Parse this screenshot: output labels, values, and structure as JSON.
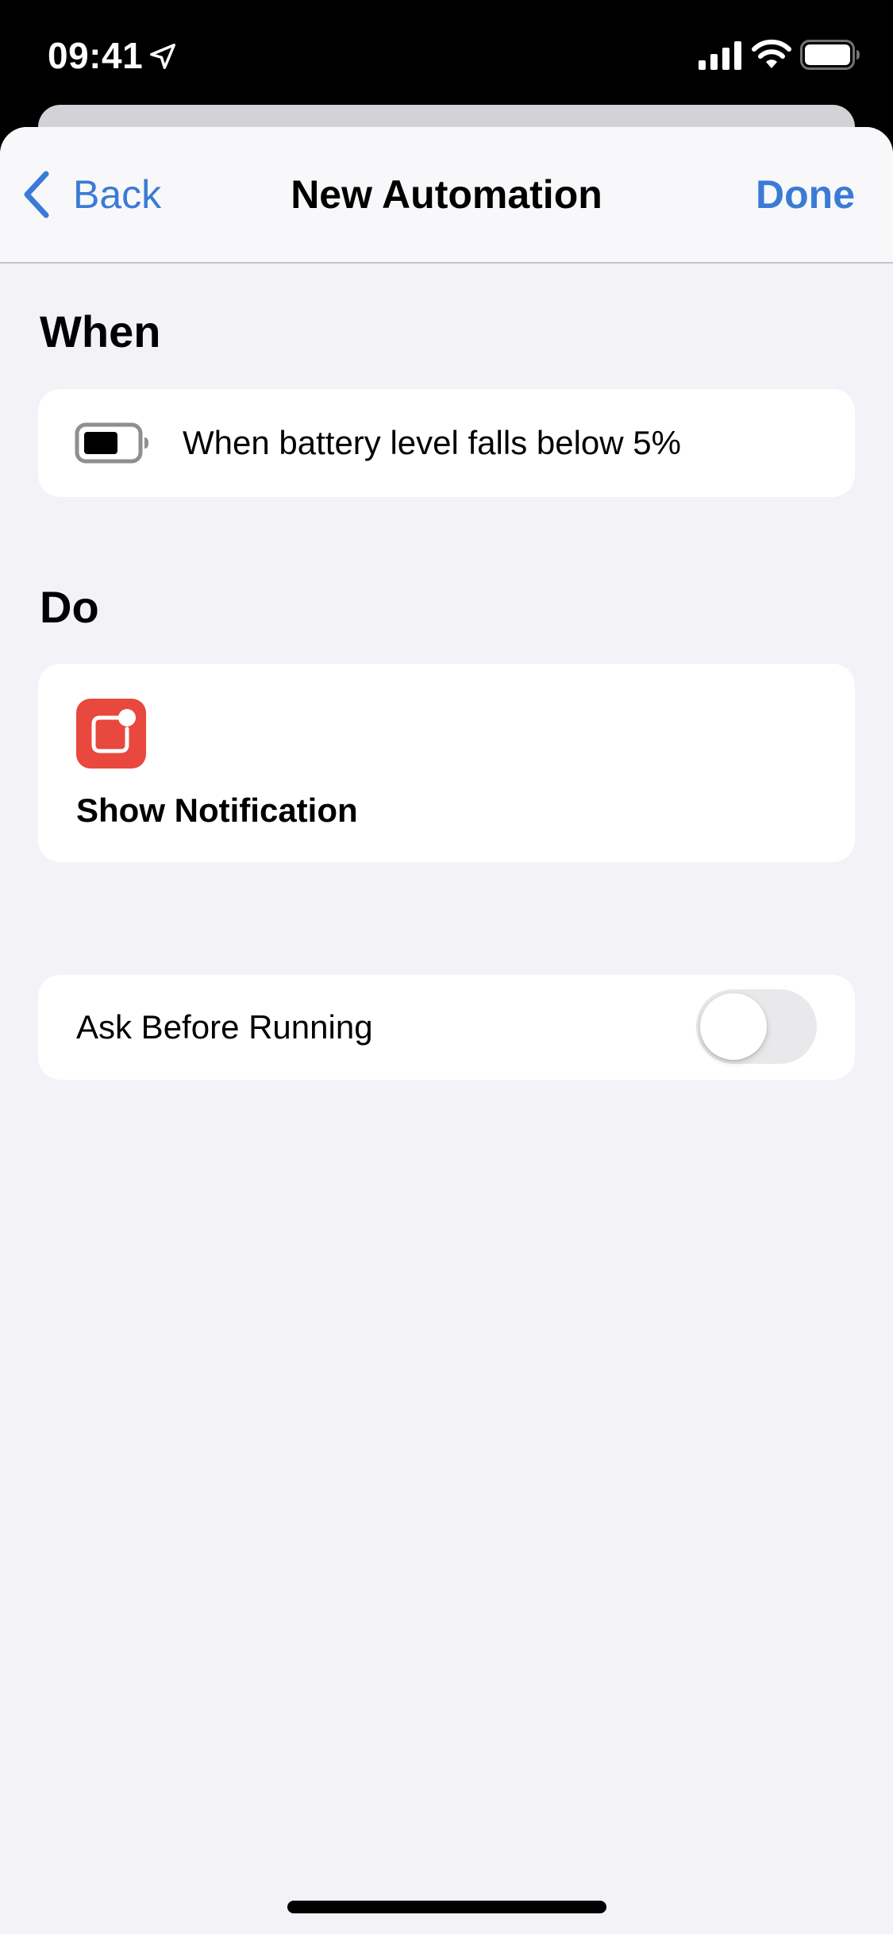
{
  "status_bar": {
    "time": "09:41",
    "icons": [
      "location-arrow-icon",
      "cellular-signal-icon",
      "wifi-icon",
      "battery-icon"
    ]
  },
  "nav": {
    "back_label": "Back",
    "title": "New Automation",
    "done_label": "Done"
  },
  "when_section": {
    "header": "When",
    "trigger_icon": "battery-low-icon",
    "trigger_text": "When battery level falls below 5%"
  },
  "do_section": {
    "header": "Do",
    "action_icon": "notification-icon",
    "action_label": "Show Notification"
  },
  "ask_before_running": {
    "label": "Ask Before Running",
    "enabled": false
  },
  "colors": {
    "accent": "#3a7bd5",
    "notification_red": "#e8483d",
    "background": "#f2f2f7",
    "card": "#ffffff"
  }
}
